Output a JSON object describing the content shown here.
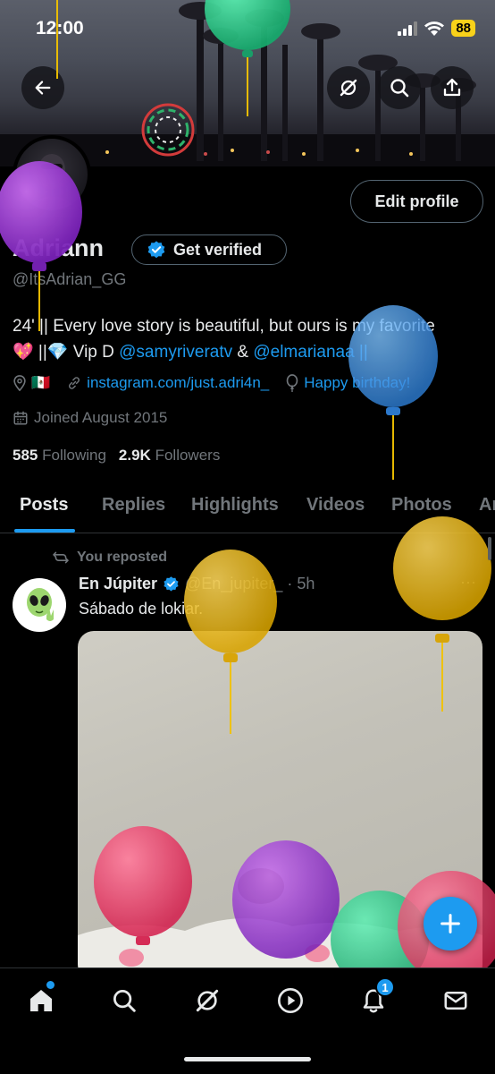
{
  "status_bar": {
    "time": "12:00",
    "battery": "88"
  },
  "header_buttons": {
    "back_icon": "arrow-left-icon",
    "grok_icon": "grok-icon",
    "search_icon": "search-icon",
    "share_icon": "share-icon"
  },
  "profile": {
    "name": "Adriann",
    "handle": "@ItsAdrian_GG",
    "edit_profile_label": "Edit profile",
    "get_verified_label": "Get verified",
    "bio_line1": "24' || Every love story is beautiful, but ours is my favorite",
    "bio_line2_prefix": "💖 ||💎 Vip D ",
    "bio_mention1": "@samyriveratv",
    "bio_amp": " & ",
    "bio_mention2": "@elmarianaa ||",
    "location": "🇲🇽",
    "website": "instagram.com/just.adri4n_",
    "birthday": "Happy birthday!",
    "joined": "Joined August 2015",
    "following_count": "585",
    "following_label": "Following",
    "followers_count": "2.9K",
    "followers_label": "Followers"
  },
  "tabs": [
    {
      "label": "Posts",
      "active": true
    },
    {
      "label": "Replies"
    },
    {
      "label": "Highlights"
    },
    {
      "label": "Videos"
    },
    {
      "label": "Photos"
    },
    {
      "label": "Ar"
    }
  ],
  "post": {
    "repost_label": "You reposted",
    "author": "En Júpiter",
    "handle_time": "@En_jupiter_ · 5h",
    "more": "···",
    "text": "Sábado de lokiar."
  },
  "bottom_nav": {
    "items": [
      "home-icon",
      "search-icon",
      "grok-icon",
      "video-icon",
      "bell-icon",
      "mail-icon"
    ],
    "notification_count": "1"
  },
  "colors": {
    "accent": "#1d9bf0",
    "background": "#000000",
    "muted_text": "#71767b",
    "primary_text": "#e7e9ea"
  }
}
